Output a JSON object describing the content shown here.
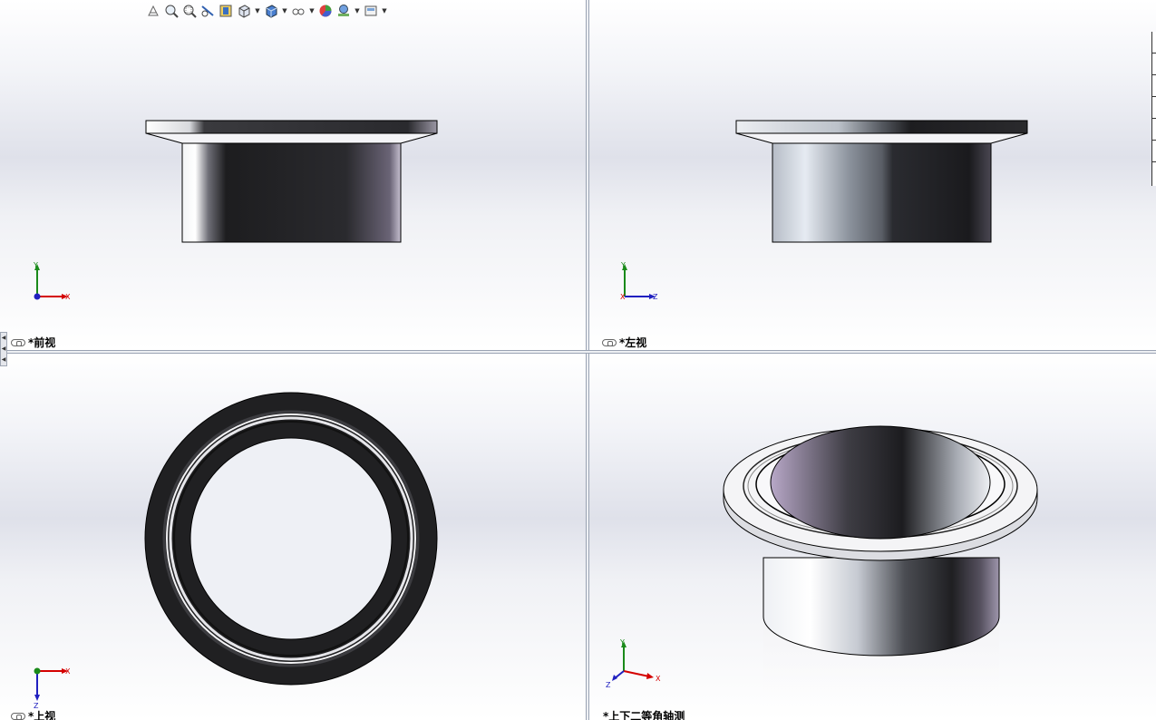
{
  "viewports": {
    "front": {
      "name": "*前视",
      "axes": {
        "up": "Y",
        "right": "X"
      }
    },
    "left": {
      "name": "*左视",
      "axes": {
        "up": "Y",
        "right": "Z",
        "origin": "X"
      }
    },
    "top": {
      "name": "*上视",
      "axes": {
        "down": "Z",
        "right": "X"
      }
    },
    "iso": {
      "name": "*上下二等角轴测",
      "axes": {
        "up": "Y",
        "right": "X",
        "left": "Z"
      }
    }
  },
  "toolbar": {
    "items": [
      "previous-view-icon",
      "zoom-to-fit-icon",
      "zoom-to-area-icon",
      "section-view-icon",
      "dynamic-annotation-icon",
      "view-orientation-icon",
      "display-style-icon",
      "hide-show-icon",
      "edit-appearance-icon",
      "apply-scene-icon",
      "view-settings-icon"
    ]
  },
  "colors": {
    "viewport_background": "#e1e3eb",
    "axis_x": "#d40000",
    "axis_y": "#1a8a1a",
    "axis_z": "#2020c0"
  }
}
